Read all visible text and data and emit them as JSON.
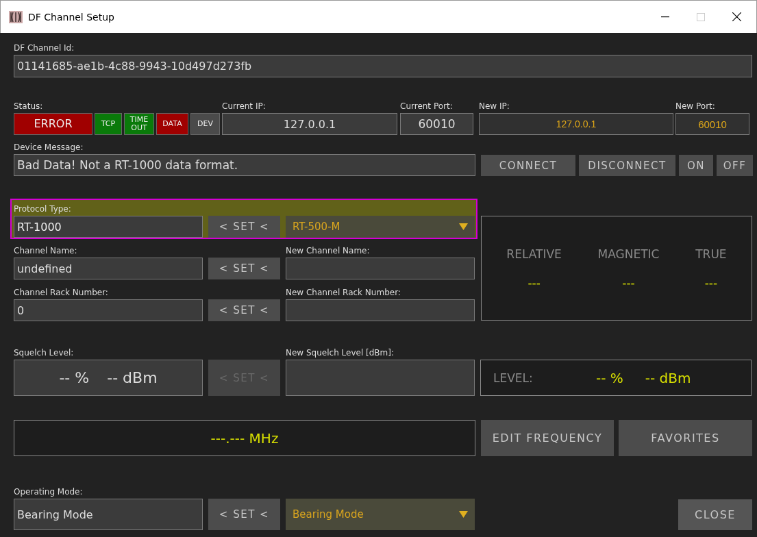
{
  "window": {
    "title": "DF Channel Setup"
  },
  "channel_id": {
    "label": "DF Channel Id:",
    "value": "01141685-ae1b-4c88-9943-10d497d273fb"
  },
  "status": {
    "label": "Status:",
    "indicators": [
      {
        "text": "ERROR",
        "color": "#a00000"
      },
      {
        "text": "TCP",
        "color": "#0a7a0a"
      },
      {
        "text": "TIME OUT",
        "color": "#0a7a0a"
      },
      {
        "text": "DATA",
        "color": "#a00000"
      },
      {
        "text": "DEV",
        "color": "#4a4a4a"
      }
    ]
  },
  "current_ip": {
    "label": "Current IP:",
    "value": "127.0.0.1"
  },
  "current_port": {
    "label": "Current Port:",
    "value": "60010"
  },
  "new_ip": {
    "label": "New IP:",
    "value": "127.0.0.1"
  },
  "new_port": {
    "label": "New Port:",
    "value": "60010"
  },
  "device_message": {
    "label": "Device Message:",
    "value": "Bad Data! Not a RT-1000 data format."
  },
  "connection_buttons": [
    "CONNECT",
    "DISCONNECT",
    "ON",
    "OFF"
  ],
  "settings": [
    {
      "label": "Protocol Type:",
      "value": "RT-1000",
      "button": "< SET <",
      "disabled": false,
      "highlighted": true,
      "kind": "dropdown",
      "new_value": "RT-500-M"
    },
    {
      "label": "Channel Name:",
      "value": "undefined",
      "button": "< SET <",
      "disabled": false,
      "highlighted": false,
      "kind": "input",
      "new_label": "New Channel Name:"
    },
    {
      "label": "Channel Rack Number:",
      "value": "0",
      "button": "< SET <",
      "disabled": false,
      "highlighted": false,
      "kind": "input",
      "new_label": "New Channel Rack Number:"
    }
  ],
  "bearings": [
    {
      "label": "RELATIVE",
      "value": "---"
    },
    {
      "label": "MAGNETIC",
      "value": "---"
    },
    {
      "label": "TRUE",
      "value": "---"
    }
  ],
  "squelch": {
    "label": "Squelch Level:",
    "values": [
      "-- %",
      "-- dBm"
    ],
    "button": "< SET <",
    "disabled": true,
    "new_label": "New Squelch Level [dBm]:"
  },
  "level": {
    "label": "LEVEL:",
    "values": [
      "-- %",
      "-- dBm"
    ]
  },
  "frequency": "---.--- MHz",
  "frequency_buttons": [
    "EDIT FREQUENCY",
    "FAVORITES"
  ],
  "operating_mode": {
    "label": "Operating Mode:",
    "value": "Bearing Mode",
    "button": "< SET <",
    "disabled": false,
    "kind": "dropdown",
    "new_value": "Bearing Mode"
  },
  "close_button": "CLOSE"
}
